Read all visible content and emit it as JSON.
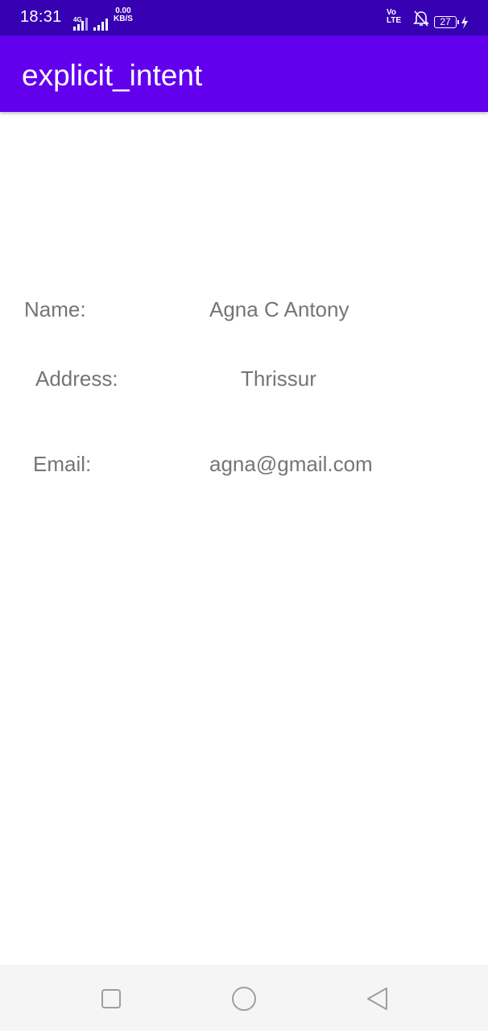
{
  "status_bar": {
    "time": "18:31",
    "network_label": "4G",
    "speed_value": "0.00",
    "speed_unit": "KB/S",
    "volte_top": "Vo",
    "volte_bottom": "LTE",
    "battery_level": "27"
  },
  "app_bar": {
    "title": "explicit_intent"
  },
  "details": {
    "name_label": "Name:",
    "name_value": "Agna C Antony",
    "address_label": "Address:",
    "address_value": "Thrissur",
    "email_label": "Email:",
    "email_value": "agna@gmail.com"
  },
  "nav_bar": {
    "icons": [
      "recent-apps-icon",
      "home-icon",
      "back-icon"
    ]
  },
  "colors": {
    "status_bar": "#3700b3",
    "app_bar": "#6200ee",
    "text": "#757575",
    "nav_bar": "#f5f5f5"
  }
}
